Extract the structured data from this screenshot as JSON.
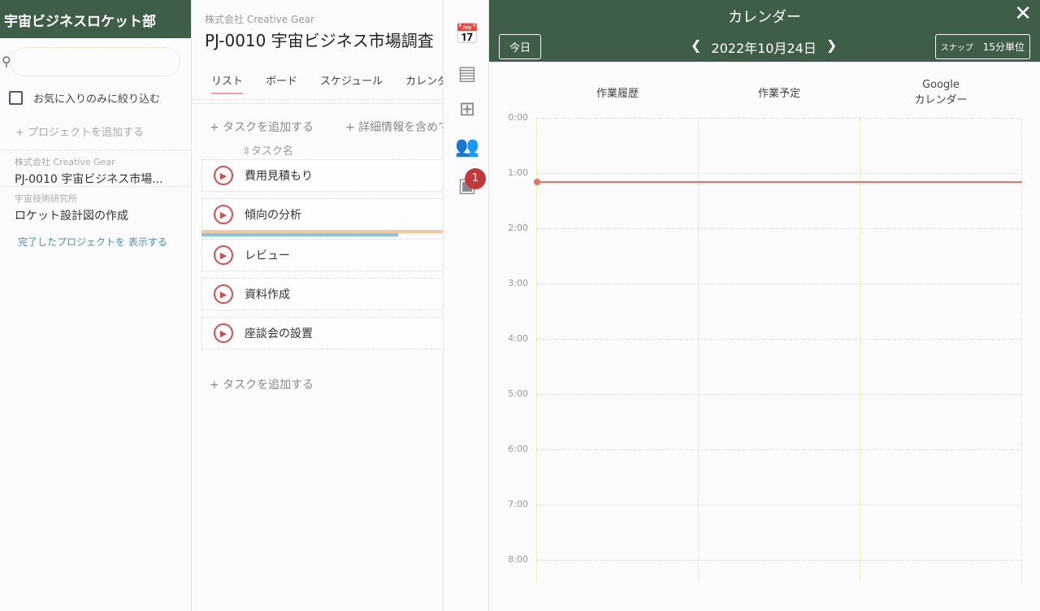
{
  "left": {
    "title": "宇宙ビジネスロケット部",
    "search_placeholder": "",
    "fav_label": "お気に入りのみに絞り込む",
    "add_project": "+ プロジェクトを追加する",
    "projects": [
      {
        "company": "株式会社 Creative Gear",
        "name": "PJ-0010 宇宙ビジネス市場..."
      },
      {
        "company": "宇宙技術研究所",
        "name": "ロケット設計図の作成"
      }
    ],
    "show_done": "完了したプロジェクトを 表示する"
  },
  "project": {
    "company": "株式会社 Creative Gear",
    "title": "PJ-0010 宇宙ビジネス市場調査",
    "tabs": [
      "リスト",
      "ボード",
      "スケジュール",
      "カレンダー"
    ],
    "add_task": "+ タスクを追加する",
    "add_detail": "+ 詳細情報を含めて追加する",
    "column": "⇳タスク名",
    "tasks": [
      "費用見積もり",
      "傾向の分析",
      "レビュー",
      "資料作成",
      "座談会の設置"
    ],
    "add_task_bottom": "+ タスクを追加する"
  },
  "side": {
    "icons": [
      "calendar-icon",
      "task-list-icon",
      "add-task-icon",
      "members-icon",
      "notification-icon"
    ],
    "badge": "1"
  },
  "calendar": {
    "title": "カレンダー",
    "today": "今日",
    "date": "2022年10月24日",
    "snap_label": "スナップ",
    "snap_value": "15分単位",
    "columns": [
      "作業履歴",
      "作業予定",
      "Google\nカレンダー"
    ],
    "hours": [
      "0:00",
      "1:00",
      "2:00",
      "3:00",
      "4:00",
      "5:00",
      "6:00",
      "7:00",
      "8:00"
    ],
    "current_time": "1:09",
    "colors": {
      "header": "#3e5e48",
      "now": "#f07060"
    }
  }
}
